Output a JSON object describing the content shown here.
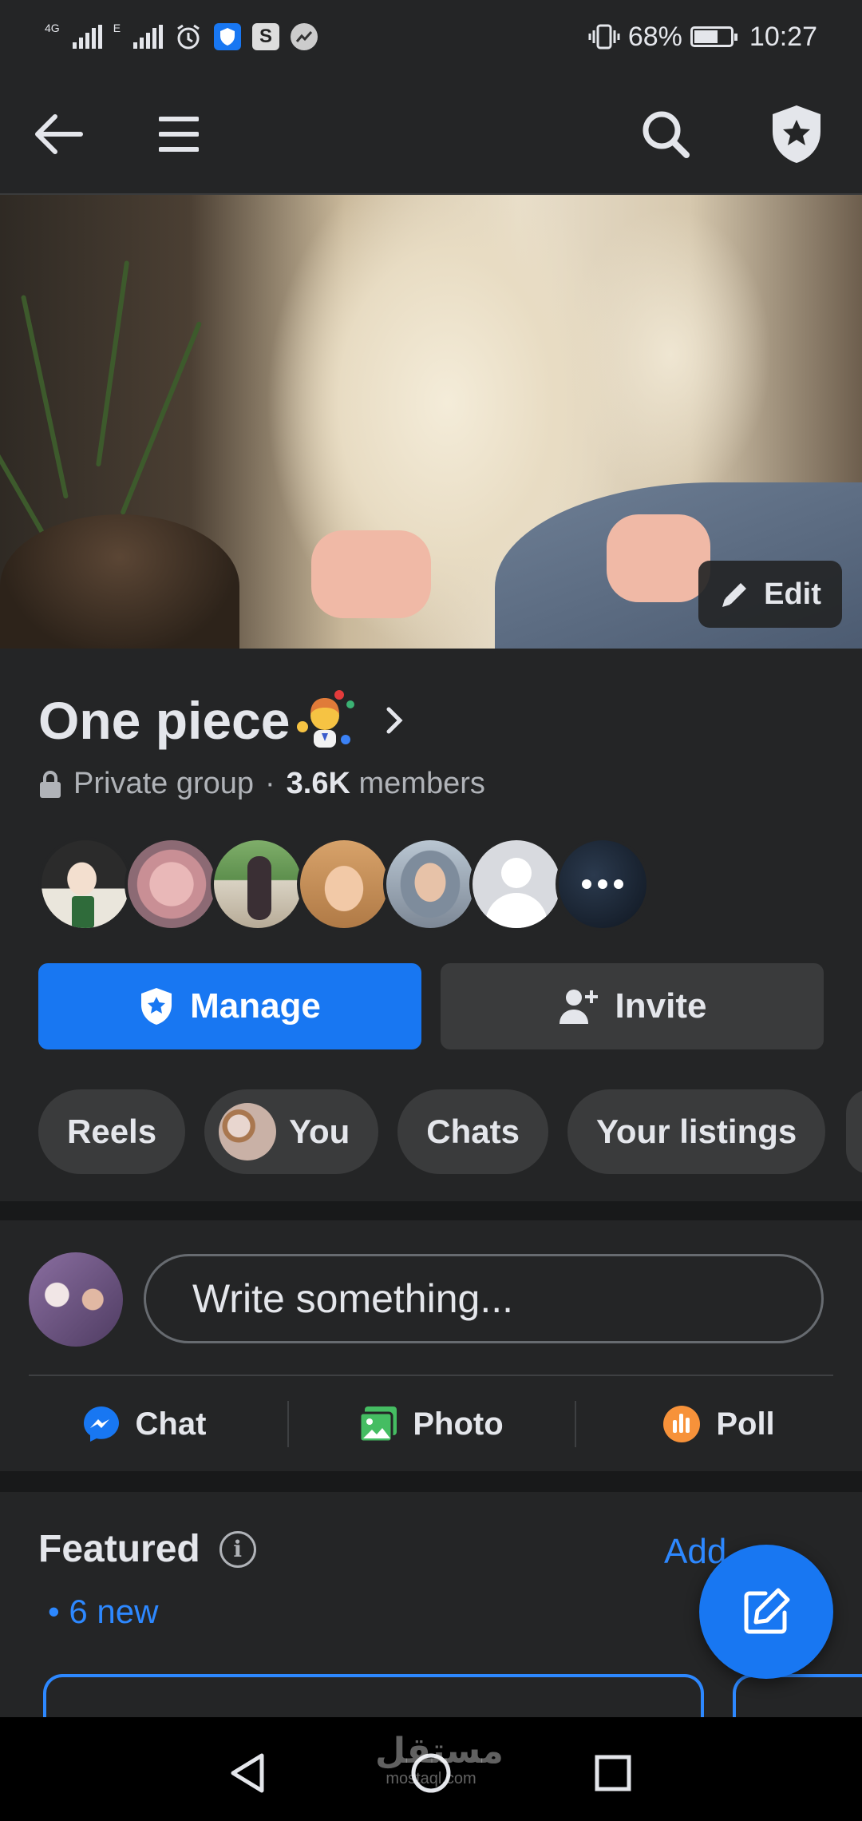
{
  "status_bar": {
    "net1": "4G",
    "net2": "E",
    "battery_percent": "68%",
    "battery_level": 0.68,
    "time": "10:27"
  },
  "top_nav": {
    "back_icon": "arrow-left-icon",
    "menu_icon": "hamburger-menu-icon",
    "search_icon": "search-icon",
    "admin_icon": "shield-star-icon"
  },
  "cover": {
    "edit_label": "Edit"
  },
  "group": {
    "name": "One piece",
    "privacy": "Private group",
    "separator": "·",
    "member_count": "3.6K",
    "members_label": "members"
  },
  "actions": {
    "manage_label": "Manage",
    "invite_label": "Invite"
  },
  "chips": [
    {
      "label": "Reels"
    },
    {
      "label": "You"
    },
    {
      "label": "Chats"
    },
    {
      "label": "Your listings"
    }
  ],
  "composer": {
    "placeholder": "Write something...",
    "actions": [
      {
        "label": "Chat",
        "icon": "messenger-icon",
        "color": "#1877f2"
      },
      {
        "label": "Photo",
        "icon": "photo-icon",
        "color": "#45bd62"
      },
      {
        "label": "Poll",
        "icon": "poll-icon",
        "color": "#f7b928"
      }
    ]
  },
  "featured": {
    "title": "Featured",
    "new_label": "• 6 new",
    "add_label": "Add"
  },
  "watermark": {
    "arabic": "مستقل",
    "latin": "mostaql.com"
  },
  "colors": {
    "accent": "#1877f2",
    "link": "#2d88ff",
    "surface": "#242526",
    "background": "#18191a"
  }
}
